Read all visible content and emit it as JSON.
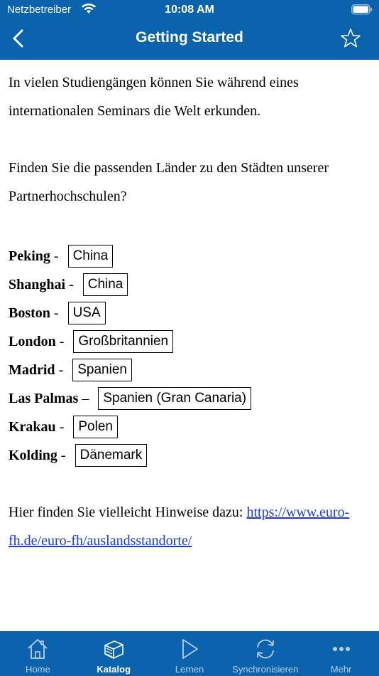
{
  "status_bar": {
    "carrier": "Netzbetreiber",
    "time": "10:08 AM"
  },
  "nav": {
    "title": "Getting Started",
    "back_icon": "chevron-left-icon",
    "star_icon": "star-outline-icon"
  },
  "content": {
    "intro": "In vielen Studiengängen können Sie während eines internationalen Seminars die Welt erkunden.",
    "question": "Finden Sie die passenden Länder zu den Städten unserer Partnerhochschulen?",
    "pairs": [
      {
        "city": "Peking",
        "sep": " - ",
        "answer": "China"
      },
      {
        "city": "Shanghai",
        "sep": " - ",
        "answer": "China"
      },
      {
        "city": "Boston",
        "sep": " - ",
        "answer": "USA"
      },
      {
        "city": "London",
        "sep": " - ",
        "answer": "Großbritannien"
      },
      {
        "city": "Madrid",
        "sep": " - ",
        "answer": "Spanien"
      },
      {
        "city": "Las Palmas",
        "sep": " – ",
        "answer": "Spanien (Gran Canaria)"
      },
      {
        "city": "Krakau",
        "sep": " - ",
        "answer": "Polen"
      },
      {
        "city": "Kolding",
        "sep": " - ",
        "answer": "Dänemark"
      }
    ],
    "hint_prefix": "Hier finden Sie vielleicht Hinweise dazu: ",
    "hint_link": "https://www.euro-fh.de/euro-fh/auslandsstandorte/"
  },
  "tabs": [
    {
      "label": "Home",
      "icon": "home-icon",
      "active": false
    },
    {
      "label": "Katalog",
      "icon": "catalog-icon",
      "active": true
    },
    {
      "label": "Lernen",
      "icon": "play-icon",
      "active": false
    },
    {
      "label": "Synchronisieren",
      "icon": "sync-icon",
      "active": false
    },
    {
      "label": "Mehr",
      "icon": "more-icon",
      "active": false
    }
  ],
  "colors": {
    "header_blue": "#0c63ad",
    "link_blue": "#1a3ccf",
    "tab_inactive": "#b9cfe6"
  }
}
